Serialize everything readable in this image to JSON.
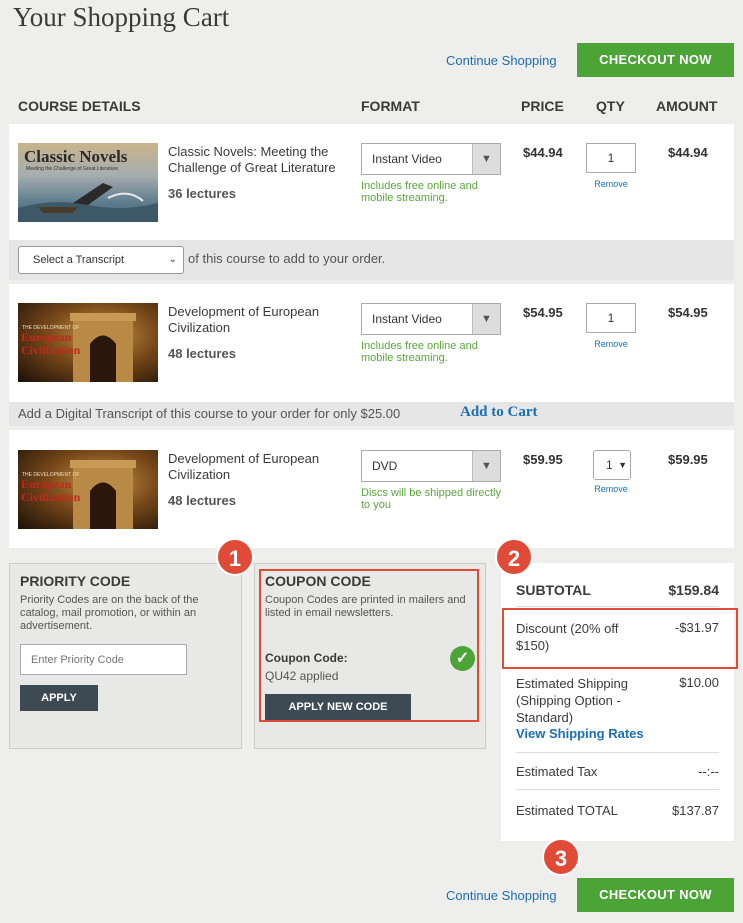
{
  "page": {
    "title": "Your Shopping Cart",
    "continue_shopping": "Continue Shopping",
    "checkout_now": "CHECKOUT NOW"
  },
  "table": {
    "headers": [
      "COURSE DETAILS",
      "FORMAT",
      "PRICE",
      "QTY",
      "AMOUNT"
    ]
  },
  "items": [
    {
      "thumb_title": "Classic Novels",
      "thumb_subtitle": "Meeting the Challenge of Great Literature",
      "name": "Classic Novels: Meeting the Challenge of Great Literature",
      "lectures": "36 lectures",
      "format": "Instant Video",
      "note": "Includes free online and mobile streaming.",
      "price": "$44.94",
      "qty": "1",
      "remove": "Remove",
      "amount": "$44.94"
    },
    {
      "thumb_small": "THE DEVELOPMENT OF",
      "thumb_title": "European Civilization",
      "name": "Development of European Civilization",
      "lectures": "48 lectures",
      "format": "Instant Video",
      "note": "Includes free online and mobile streaming.",
      "price": "$54.95",
      "qty": "1",
      "remove": "Remove",
      "amount": "$54.95"
    },
    {
      "thumb_small": "THE DEVELOPMENT OF",
      "thumb_title": "European Civilization",
      "name": "Development of European Civilization",
      "lectures": "48 lectures",
      "format": "DVD",
      "note": "Discs will be shipped directly to you",
      "price": "$59.95",
      "qty": "1",
      "remove": "Remove",
      "amount": "$59.95"
    }
  ],
  "transcript": {
    "select_placeholder": "Select a Transcript",
    "select_suffix": "of this course to add to your order.",
    "digital_offer": "Add a Digital Transcript of this course to your order for only $25.00",
    "add_to_cart": "Add to Cart"
  },
  "priority": {
    "title": "PRIORITY CODE",
    "desc": "Priority Codes are on the back of the catalog, mail promotion, or within an advertisement.",
    "placeholder": "Enter Priority Code",
    "apply": "APPLY"
  },
  "coupon": {
    "title": "COUPON CODE",
    "desc": "Coupon Codes are printed in mailers and listed in email newsletters.",
    "label": "Coupon Code:",
    "applied": "QU42 applied",
    "apply_new": "APPLY NEW CODE"
  },
  "summary": {
    "subtotal_label": "SUBTOTAL",
    "subtotal_value": "$159.84",
    "discount_label": "Discount (20% off $150)",
    "discount_value": "-$31.97",
    "shipping_label": "Estimated Shipping (Shipping Option - Standard)",
    "shipping_value": "$10.00",
    "shipping_rates_link": "View Shipping Rates",
    "tax_label": "Estimated Tax",
    "tax_value": "--:--",
    "total_label": "Estimated TOTAL",
    "total_value": "$137.87"
  },
  "callouts": [
    "1",
    "2",
    "3"
  ],
  "colors": {
    "accent_green": "#4da436",
    "link_blue": "#1a6fb5",
    "callout_red": "#e04a37",
    "dark_button": "#3d4a54"
  }
}
